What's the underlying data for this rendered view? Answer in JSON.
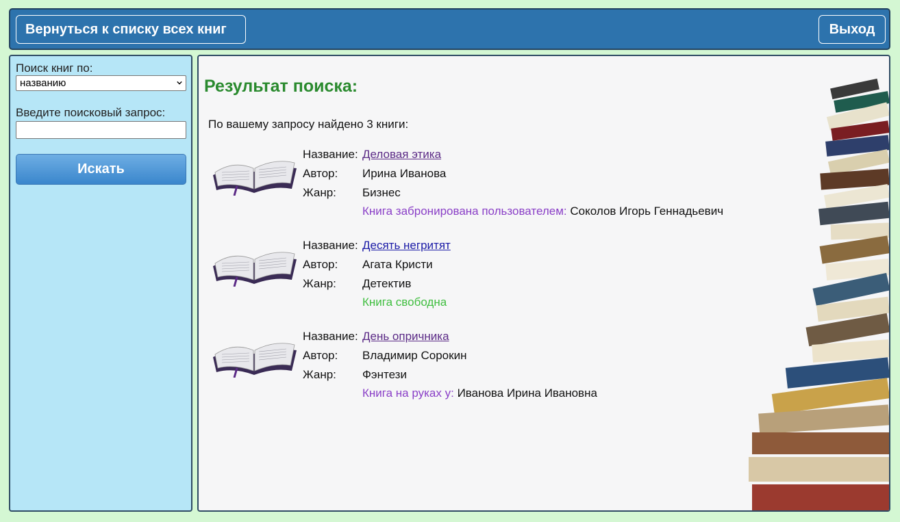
{
  "header": {
    "back_label": "Вернуться к списку всех книг",
    "exit_label": "Выход"
  },
  "sidebar": {
    "search_by_label": "Поиск книг по:",
    "search_by_value": "названию",
    "query_label": "Введите поисковый запрос:",
    "query_value": "",
    "search_button": "Искать"
  },
  "main": {
    "title": "Результат поиска:",
    "found_text": "По вашему запросу найдено 3 книги:",
    "field_labels": {
      "title": "Название:",
      "author": "Автор:",
      "genre": "Жанр:"
    },
    "books": [
      {
        "title": "Деловая этика",
        "author": "Ирина Иванова",
        "genre": "Бизнес",
        "status_label": "Книга забронирована пользователем:",
        "status_user": "Соколов Игорь Геннадьевич"
      },
      {
        "title": "Десять негритят",
        "author": "Агата Кристи",
        "genre": "Детектив",
        "status_label": "Книга свободна",
        "status_user": ""
      },
      {
        "title": "День опричника",
        "author": "Владимир Сорокин",
        "genre": "Фэнтези",
        "status_label": "Книга на руках у:",
        "status_user": "Иванова Ирина Ивановна"
      }
    ]
  },
  "colors": {
    "page_bg": "#d4f7d3",
    "header_bg": "#2d73ad",
    "sidebar_bg": "#b6e6f7",
    "title_green": "#2a8a2e",
    "status_purple": "#8a3fc7",
    "status_green": "#3fbe3f"
  }
}
